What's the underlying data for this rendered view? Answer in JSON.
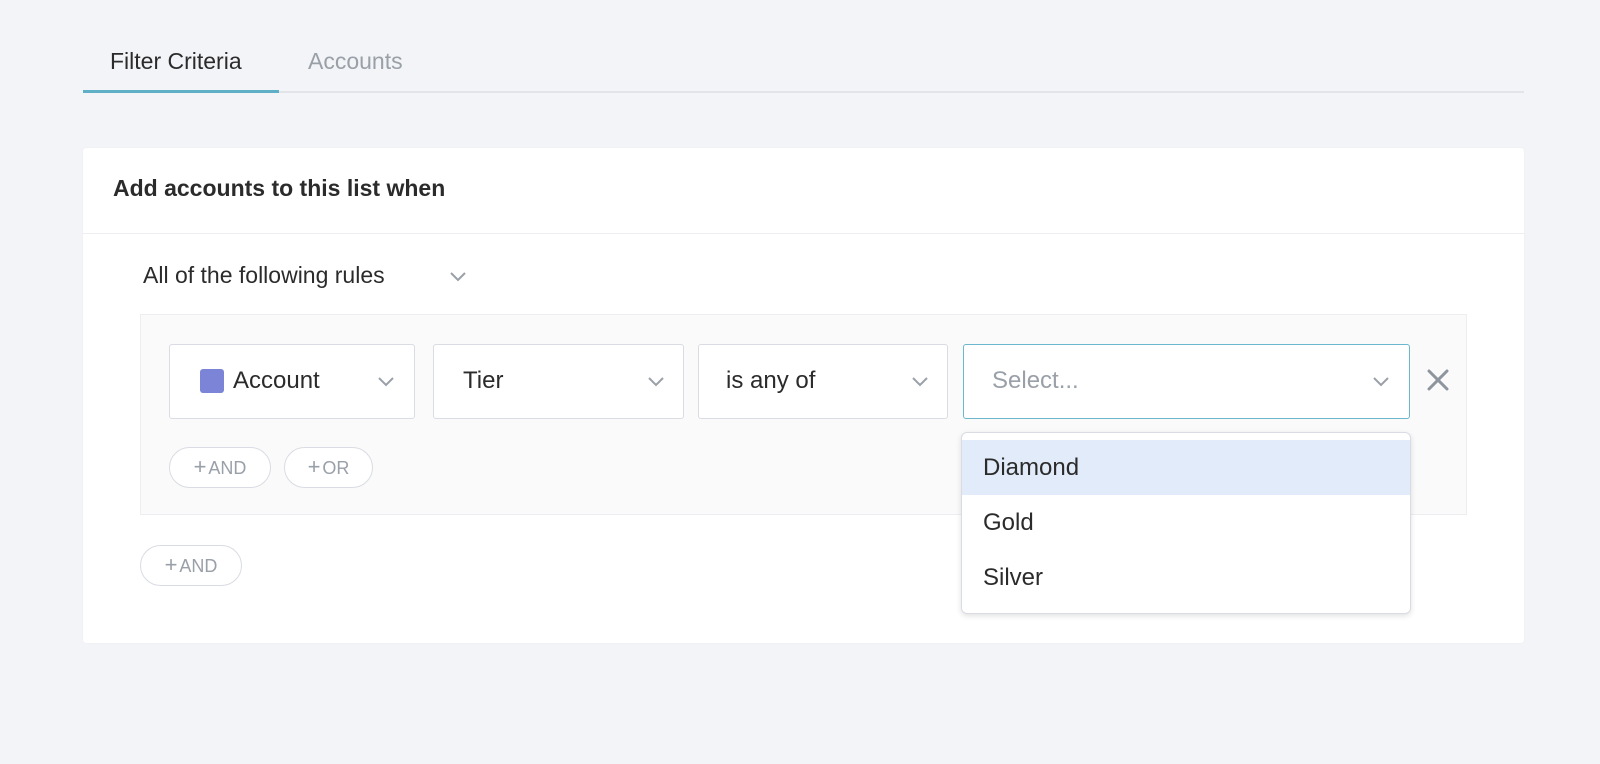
{
  "tabs": [
    {
      "label": "Filter Criteria",
      "active": true
    },
    {
      "label": "Accounts",
      "active": false
    }
  ],
  "card": {
    "title": "Add accounts to this list when",
    "rules_mode": "All of the following rules"
  },
  "rule": {
    "object": "Account",
    "field": "Tier",
    "operator": "is any of",
    "value_placeholder": "Select..."
  },
  "buttons": {
    "and_inner": "AND",
    "or_inner": "OR",
    "and_outer": "AND",
    "plus": "+"
  },
  "dropdown": {
    "options": [
      "Diamond",
      "Gold",
      "Silver"
    ],
    "highlighted": "Diamond"
  },
  "colors": {
    "accent": "#5fb0c6",
    "background": "#f3f4f8",
    "account_icon": "#7b84d6",
    "highlight": "#e1ebf9"
  },
  "icons": {
    "chevron": "chevron-down-icon",
    "remove": "close-icon",
    "account": "building-icon"
  }
}
